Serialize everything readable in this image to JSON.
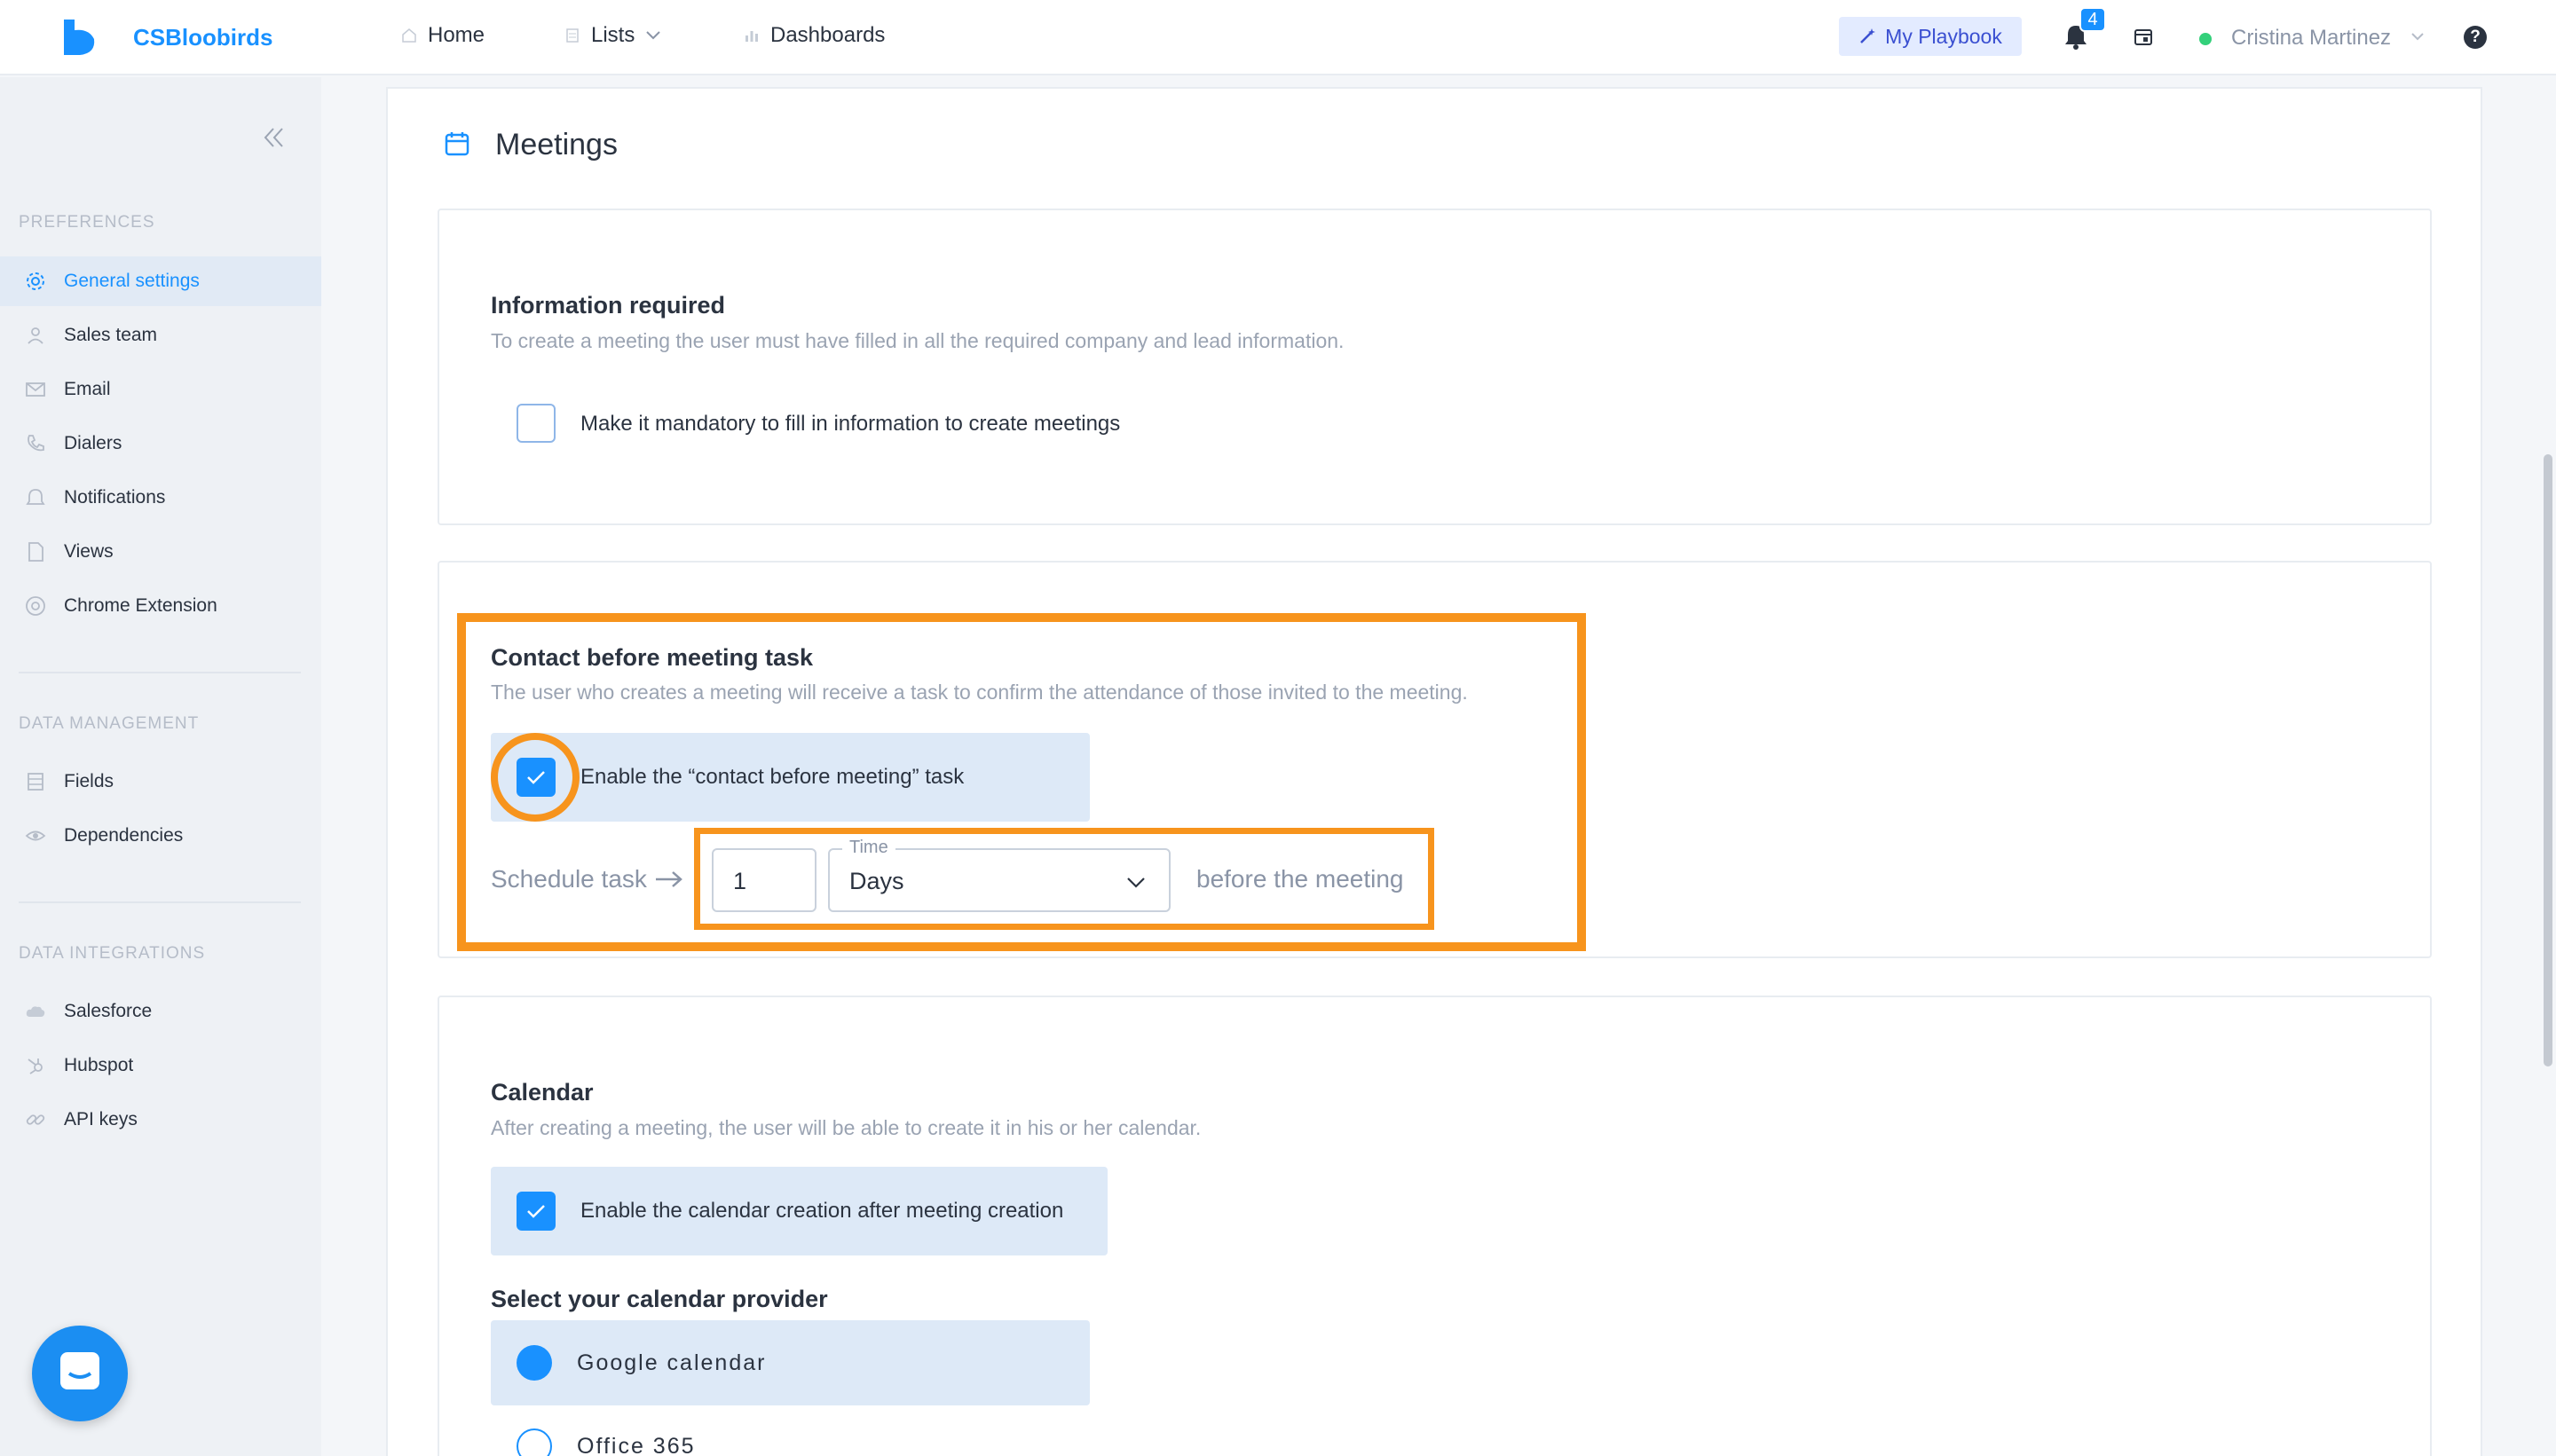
{
  "app": {
    "name": "CSBloobirds"
  },
  "nav": {
    "home": "Home",
    "lists": "Lists",
    "dashboards": "Dashboards",
    "playbook": "My Playbook",
    "notification_count": "4",
    "user_name": "Cristina Martinez",
    "help": "?"
  },
  "sidebar": {
    "sections": [
      {
        "title": "PREFERENCES",
        "items": [
          {
            "label": "General settings",
            "icon": "gear-icon",
            "active": true
          },
          {
            "label": "Sales team",
            "icon": "user-icon"
          },
          {
            "label": "Email",
            "icon": "mail-icon"
          },
          {
            "label": "Dialers",
            "icon": "phone-icon"
          },
          {
            "label": "Notifications",
            "icon": "bell-icon"
          },
          {
            "label": "Views",
            "icon": "file-icon"
          },
          {
            "label": "Chrome Extension",
            "icon": "chrome-icon"
          }
        ]
      },
      {
        "title": "DATA MANAGEMENT",
        "items": [
          {
            "label": "Fields",
            "icon": "list-icon"
          },
          {
            "label": "Dependencies",
            "icon": "eye-icon"
          }
        ]
      },
      {
        "title": "DATA INTEGRATIONS",
        "items": [
          {
            "label": "Salesforce",
            "icon": "cloud-icon"
          },
          {
            "label": "Hubspot",
            "icon": "hubspot-icon"
          },
          {
            "label": "API keys",
            "icon": "link-icon"
          }
        ]
      }
    ]
  },
  "page": {
    "title": "Meetings",
    "info_required": {
      "title": "Information required",
      "description": "To create a meeting the user must have filled in all the required company and lead information.",
      "checkbox_label": "Make it mandatory to fill in information to create meetings",
      "checked": false
    },
    "contact_before": {
      "title": "Contact before meeting task",
      "description": "The user who creates a meeting will receive a task to confirm the attendance of those invited to the meeting.",
      "checkbox_label": "Enable the “contact before meeting” task",
      "checked": true,
      "schedule_label": "Schedule task",
      "amount": "1",
      "time_legend": "Time",
      "time_unit": "Days",
      "after_label": "before the meeting"
    },
    "calendar": {
      "title": "Calendar",
      "description": "After creating a meeting, the user will be able to create it in his or her calendar.",
      "checkbox_label": "Enable the calendar creation after meeting creation",
      "checked": true,
      "provider_title": "Select your calendar provider",
      "providers": [
        {
          "label": "Google calendar",
          "selected": true
        },
        {
          "label": "Office 365",
          "selected": false
        }
      ]
    }
  },
  "colors": {
    "accent": "#1991ff",
    "highlight": "#f7941d",
    "sidebar_bg": "#eef1f5",
    "online": "#33d07a"
  }
}
